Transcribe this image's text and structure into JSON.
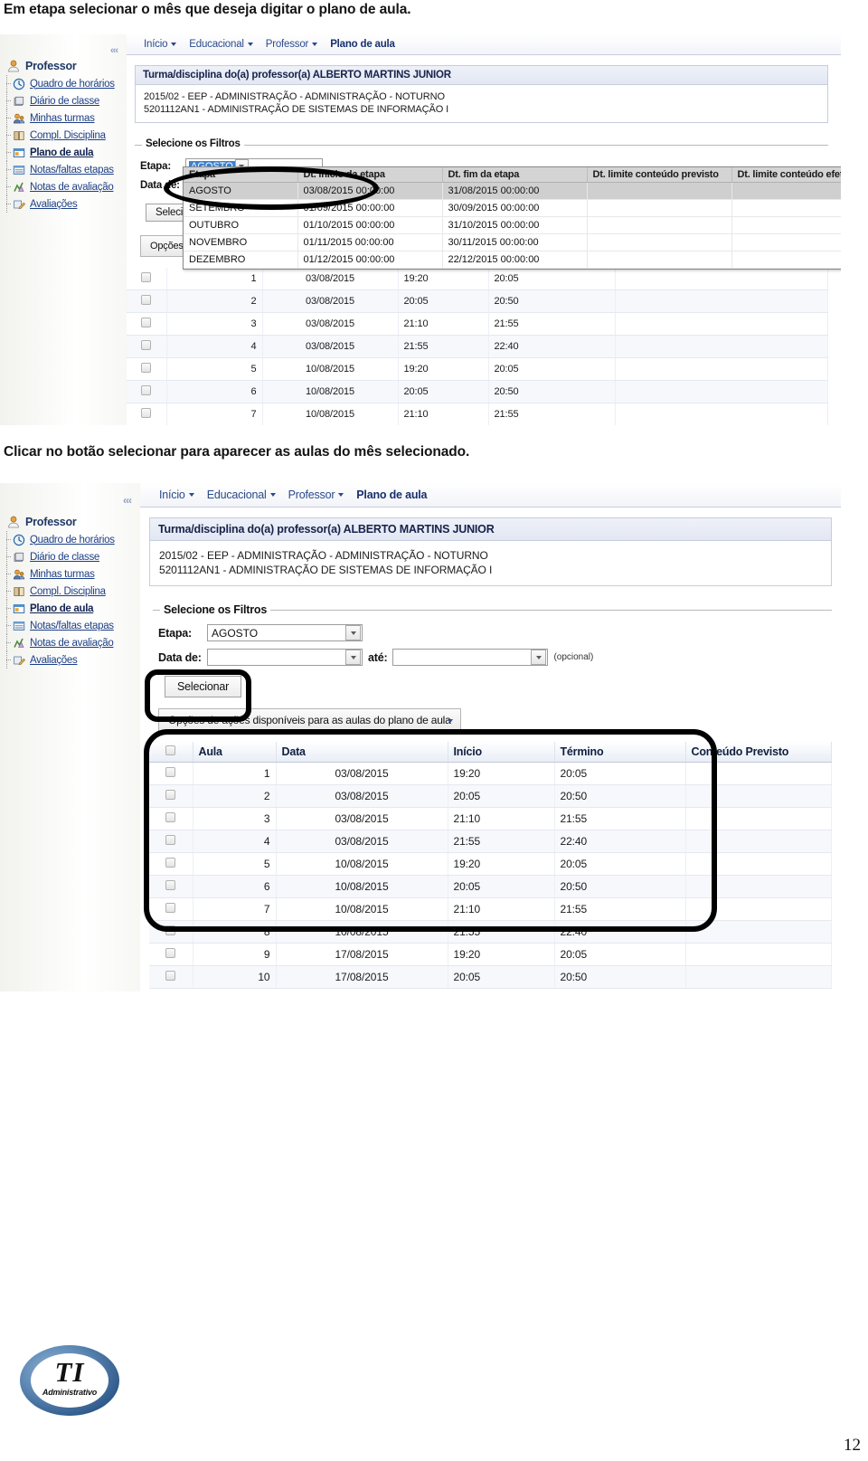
{
  "document": {
    "caption_1": "Em etapa selecionar o mês que deseja digitar o plano de aula.",
    "caption_2": "Clicar no botão selecionar para aparecer as aulas do mês selecionado.",
    "page_number": "12",
    "logo": {
      "title": "TI",
      "subtitle": "Administrativo"
    }
  },
  "app": {
    "menu": [
      {
        "label": "Início",
        "has_caret": true,
        "current": false
      },
      {
        "label": "Educacional",
        "has_caret": true,
        "current": false
      },
      {
        "label": "Professor",
        "has_caret": true,
        "current": false
      },
      {
        "label": "Plano de aula",
        "has_caret": false,
        "current": true
      }
    ],
    "sidebar": {
      "root": {
        "label": "Professor",
        "icon": "user-icon"
      },
      "items": [
        {
          "label": "Quadro de horários",
          "icon": "clock-icon",
          "active": false
        },
        {
          "label": "Diário de classe",
          "icon": "notebook-icon",
          "active": false
        },
        {
          "label": "Minhas turmas",
          "icon": "group-icon",
          "active": false
        },
        {
          "label": "Compl. Disciplina",
          "icon": "book-icon",
          "active": false
        },
        {
          "label": "Plano de aula",
          "icon": "window-icon",
          "active": true
        },
        {
          "label": "Notas/faltas etapas",
          "icon": "list-icon",
          "active": false
        },
        {
          "label": "Notas de avaliação",
          "icon": "chart-icon",
          "active": false
        },
        {
          "label": "Avaliações",
          "icon": "pencil-icon",
          "active": false
        }
      ]
    },
    "panel": {
      "title": "Turma/disciplina do(a) professor(a) ALBERTO MARTINS JUNIOR",
      "line_1": "2015/02 - EEP - ADMINISTRAÇÃO - ADMINISTRAÇÃO - NOTURNO",
      "line_2": "5201112AN1 - ADMINISTRAÇÃO DE SISTEMAS DE INFORMAÇÃO I"
    },
    "filters": {
      "legend": "Selecione os Filtros",
      "etapa_label": "Etapa:",
      "etapa_value": "AGOSTO",
      "data_de_label": "Data de:",
      "data_de_value": "",
      "ate_label": "até:",
      "ate_value": "",
      "optional_note": "(opcional)",
      "select_button": "Selecionar"
    },
    "actions_button": "Opções de ações disponíveis para as aulas do plano de aula",
    "actions_button_truncated": "Opções de",
    "etapa_dropdown": {
      "headers": [
        "Etapa",
        "Dt. início da etapa",
        "Dt. fim da etapa",
        "Dt. limite conteúdo previsto",
        "Dt. limite conteúdo efetivo"
      ],
      "rows": [
        {
          "etapa": "AGOSTO",
          "inicio": "03/08/2015 00:00:00",
          "fim": "31/08/2015 00:00:00",
          "limite_previsto": "",
          "limite_efetivo": "",
          "highlighted": true
        },
        {
          "etapa": "SETEMBRO",
          "inicio": "01/09/2015 00:00:00",
          "fim": "30/09/2015 00:00:00",
          "limite_previsto": "",
          "limite_efetivo": "",
          "highlighted": false
        },
        {
          "etapa": "OUTUBRO",
          "inicio": "01/10/2015 00:00:00",
          "fim": "31/10/2015 00:00:00",
          "limite_previsto": "",
          "limite_efetivo": "",
          "highlighted": false
        },
        {
          "etapa": "NOVEMBRO",
          "inicio": "01/11/2015 00:00:00",
          "fim": "30/11/2015 00:00:00",
          "limite_previsto": "",
          "limite_efetivo": "",
          "highlighted": false
        },
        {
          "etapa": "DEZEMBRO",
          "inicio": "01/12/2015 00:00:00",
          "fim": "22/12/2015 00:00:00",
          "limite_previsto": "",
          "limite_efetivo": "",
          "highlighted": false
        }
      ]
    },
    "lessons_grid": {
      "headers": [
        "",
        "Aula",
        "Data",
        "Início",
        "Término",
        "Conteúdo Previsto"
      ],
      "rows": [
        {
          "aula": "1",
          "data": "03/08/2015",
          "inicio": "19:20",
          "termino": "20:05",
          "conteudo": ""
        },
        {
          "aula": "2",
          "data": "03/08/2015",
          "inicio": "20:05",
          "termino": "20:50",
          "conteudo": ""
        },
        {
          "aula": "3",
          "data": "03/08/2015",
          "inicio": "21:10",
          "termino": "21:55",
          "conteudo": ""
        },
        {
          "aula": "4",
          "data": "03/08/2015",
          "inicio": "21:55",
          "termino": "22:40",
          "conteudo": ""
        },
        {
          "aula": "5",
          "data": "10/08/2015",
          "inicio": "19:20",
          "termino": "20:05",
          "conteudo": ""
        },
        {
          "aula": "6",
          "data": "10/08/2015",
          "inicio": "20:05",
          "termino": "20:50",
          "conteudo": ""
        },
        {
          "aula": "7",
          "data": "10/08/2015",
          "inicio": "21:10",
          "termino": "21:55",
          "conteudo": ""
        },
        {
          "aula": "8",
          "data": "10/08/2015",
          "inicio": "21:55",
          "termino": "22:40",
          "conteudo": ""
        },
        {
          "aula": "9",
          "data": "17/08/2015",
          "inicio": "19:20",
          "termino": "20:05",
          "conteudo": ""
        },
        {
          "aula": "10",
          "data": "17/08/2015",
          "inicio": "20:05",
          "termino": "20:50",
          "conteudo": ""
        }
      ]
    }
  },
  "colors": {
    "menu_link": "#2b4a8b",
    "sidebar_link": "#1d3f86",
    "panel_title": "#16224a",
    "selection_blue": "#3a82d2",
    "annotation": "#000000",
    "logo_blue": "#2f5a8a"
  }
}
